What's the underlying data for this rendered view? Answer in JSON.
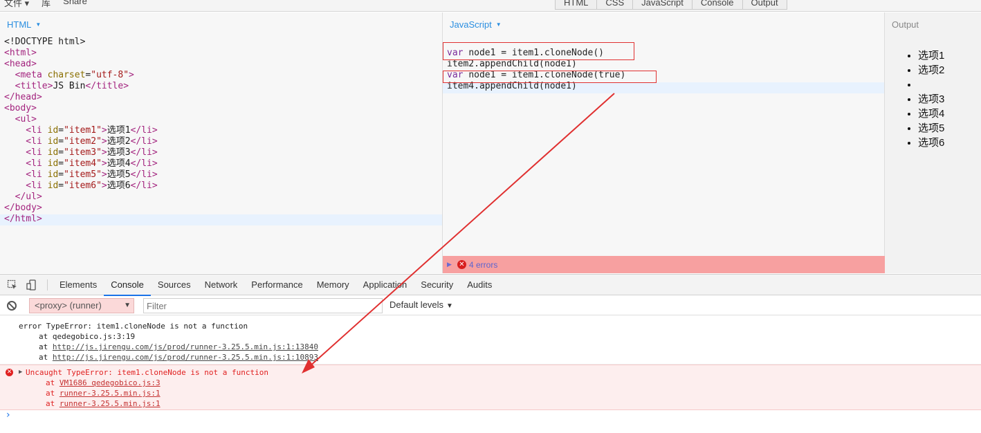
{
  "topbar": {
    "menu": [
      "文件 ▾",
      "库",
      "Share"
    ],
    "panel_tabs": [
      "HTML",
      "CSS",
      "JavaScript",
      "Console",
      "Output"
    ]
  },
  "html_panel": {
    "label": "HTML",
    "lines": [
      [
        {
          "t": "<!DOCTYPE html>",
          "c": "plain"
        }
      ],
      [
        {
          "t": "<html>",
          "c": "tag"
        }
      ],
      [
        {
          "t": "<head>",
          "c": "tag"
        }
      ],
      [
        {
          "t": "  <meta ",
          "c": "tag"
        },
        {
          "t": "charset",
          "c": "attr"
        },
        {
          "t": "=",
          "c": "plain"
        },
        {
          "t": "\"utf-8\"",
          "c": "str"
        },
        {
          "t": ">",
          "c": "tag"
        }
      ],
      [
        {
          "t": "  <title>",
          "c": "tag"
        },
        {
          "t": "JS Bin",
          "c": "txt"
        },
        {
          "t": "</title>",
          "c": "tag"
        }
      ],
      [
        {
          "t": "</head>",
          "c": "tag"
        }
      ],
      [
        {
          "t": "<body>",
          "c": "tag"
        }
      ],
      [
        {
          "t": "  <ul>",
          "c": "tag"
        }
      ],
      [
        {
          "t": "    <li ",
          "c": "tag"
        },
        {
          "t": "id",
          "c": "attr"
        },
        {
          "t": "=",
          "c": "plain"
        },
        {
          "t": "\"item1\"",
          "c": "str"
        },
        {
          "t": ">",
          "c": "tag"
        },
        {
          "t": "选项1",
          "c": "txt"
        },
        {
          "t": "</li>",
          "c": "tag"
        }
      ],
      [
        {
          "t": "    <li ",
          "c": "tag"
        },
        {
          "t": "id",
          "c": "attr"
        },
        {
          "t": "=",
          "c": "plain"
        },
        {
          "t": "\"item2\"",
          "c": "str"
        },
        {
          "t": ">",
          "c": "tag"
        },
        {
          "t": "选项2",
          "c": "txt"
        },
        {
          "t": "</li>",
          "c": "tag"
        }
      ],
      [
        {
          "t": "    <li ",
          "c": "tag"
        },
        {
          "t": "id",
          "c": "attr"
        },
        {
          "t": "=",
          "c": "plain"
        },
        {
          "t": "\"item3\"",
          "c": "str"
        },
        {
          "t": ">",
          "c": "tag"
        },
        {
          "t": "选项3",
          "c": "txt"
        },
        {
          "t": "</li>",
          "c": "tag"
        }
      ],
      [
        {
          "t": "    <li ",
          "c": "tag"
        },
        {
          "t": "id",
          "c": "attr"
        },
        {
          "t": "=",
          "c": "plain"
        },
        {
          "t": "\"item4\"",
          "c": "str"
        },
        {
          "t": ">",
          "c": "tag"
        },
        {
          "t": "选项4",
          "c": "txt"
        },
        {
          "t": "</li>",
          "c": "tag"
        }
      ],
      [
        {
          "t": "    <li ",
          "c": "tag"
        },
        {
          "t": "id",
          "c": "attr"
        },
        {
          "t": "=",
          "c": "plain"
        },
        {
          "t": "\"item5\"",
          "c": "str"
        },
        {
          "t": ">",
          "c": "tag"
        },
        {
          "t": "选项5",
          "c": "txt"
        },
        {
          "t": "</li>",
          "c": "tag"
        }
      ],
      [
        {
          "t": "    <li ",
          "c": "tag"
        },
        {
          "t": "id",
          "c": "attr"
        },
        {
          "t": "=",
          "c": "plain"
        },
        {
          "t": "\"item6\"",
          "c": "str"
        },
        {
          "t": ">",
          "c": "tag"
        },
        {
          "t": "选项6",
          "c": "txt"
        },
        {
          "t": "</li>",
          "c": "tag"
        }
      ],
      [
        {
          "t": "  </ul>",
          "c": "tag"
        }
      ],
      [
        {
          "t": "</body>",
          "c": "tag"
        }
      ],
      [
        {
          "t": "</html>",
          "c": "tag"
        }
      ]
    ]
  },
  "js_panel": {
    "label": "JavaScript",
    "lines": [
      [
        {
          "t": "var ",
          "c": "kw"
        },
        {
          "t": "node1 = item1.cloneNode()",
          "c": "plain"
        }
      ],
      [
        {
          "t": "item2.appendChild(node1)",
          "c": "plain"
        }
      ],
      [
        {
          "t": "var ",
          "c": "kw"
        },
        {
          "t": "node1 = item1.cloneNode(true)",
          "c": "plain"
        }
      ],
      [
        {
          "t": "item4.appendChild(node1)",
          "c": "plain"
        }
      ]
    ],
    "error_count_label": "4 errors"
  },
  "output_panel": {
    "label": "Output",
    "items": [
      "选项1",
      "选项2",
      "",
      "选项3",
      "选项4",
      "选项5",
      "选项6"
    ]
  },
  "devtools": {
    "tabs": [
      "Elements",
      "Console",
      "Sources",
      "Network",
      "Performance",
      "Memory",
      "Application",
      "Security",
      "Audits"
    ],
    "active_tab": "Console",
    "context": "<proxy> (runner)",
    "filter_placeholder": "Filter",
    "levels": "Default levels",
    "messages": [
      {
        "type": "log",
        "lines": [
          {
            "text": "error TypeError: item1.cloneNode is not a function",
            "link": ""
          },
          {
            "text": "at qedegobico.js:3:19",
            "link": ""
          },
          {
            "text": "at ",
            "link": "http://js.jirengu.com/js/prod/runner-3.25.5.min.js:1:13840"
          },
          {
            "text": "at ",
            "link": "http://js.jirengu.com/js/prod/runner-3.25.5.min.js:1:10893"
          }
        ]
      },
      {
        "type": "error",
        "lines": [
          {
            "text": "Uncaught TypeError: item1.cloneNode is not a function",
            "link": ""
          },
          {
            "text": "at ",
            "link": "VM1686 qedegobico.js:3"
          },
          {
            "text": "at ",
            "link": "runner-3.25.5.min.js:1"
          },
          {
            "text": "at ",
            "link": "runner-3.25.5.min.js:1"
          }
        ]
      }
    ],
    "prompt": "›"
  },
  "annotation_color": "#e03030"
}
